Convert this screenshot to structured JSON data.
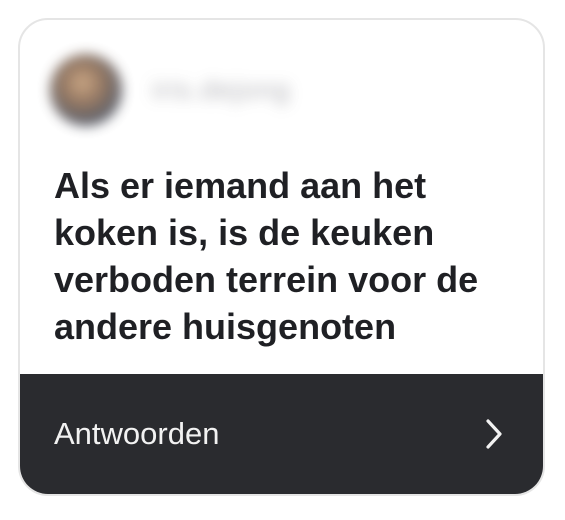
{
  "card": {
    "author": {
      "name": "iris.dejong"
    },
    "question": "Als er iemand aan het koken is, is de keuken verboden terrein voor de andere huisgenoten",
    "reply_button": {
      "label": "Antwoorden",
      "icon": "chevron-right-icon"
    }
  },
  "colors": {
    "card_background": "#ffffff",
    "bar_background": "#2a2b2f",
    "question_text": "#1f2024",
    "bar_text": "#f2f2f2"
  }
}
